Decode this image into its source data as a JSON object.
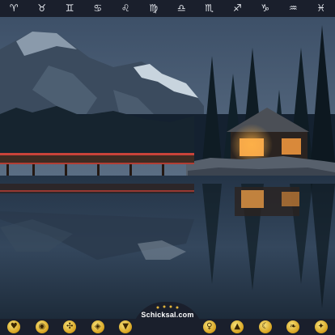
{
  "zodiac_top": [
    {
      "symbol": "♈",
      "icon": "aries-icon"
    },
    {
      "symbol": "♉",
      "icon": "taurus-icon"
    },
    {
      "symbol": "♊",
      "icon": "gemini-icon"
    },
    {
      "symbol": "♋",
      "icon": "cancer-icon"
    },
    {
      "symbol": "♌",
      "icon": "leo-icon"
    },
    {
      "symbol": "♍",
      "icon": "virgo-icon"
    },
    {
      "symbol": "♎",
      "icon": "libra-icon"
    },
    {
      "symbol": "♏",
      "icon": "scorpio-icon"
    },
    {
      "symbol": "♐",
      "icon": "sagittarius-icon"
    },
    {
      "symbol": "♑",
      "icon": "capricorn-icon"
    },
    {
      "symbol": "♒",
      "icon": "aquarius-icon"
    },
    {
      "symbol": "♓",
      "icon": "pisces-icon"
    }
  ],
  "bottom_icons": [
    "heart-icon",
    "owl-icon",
    "butterfly-icon",
    "cat-icon",
    "cat-face-icon",
    "lotus-icon",
    "yin-yang-icon",
    "woman-icon",
    "pyramid-icon",
    "moon-icon",
    "feather-icon",
    "stars-icon"
  ],
  "logo": {
    "text": "Schicksal.com"
  },
  "colors": {
    "bar_bg": "#1a1f2c",
    "icon_gold": "#e2b43a",
    "glyph": "#e6e9ef"
  }
}
